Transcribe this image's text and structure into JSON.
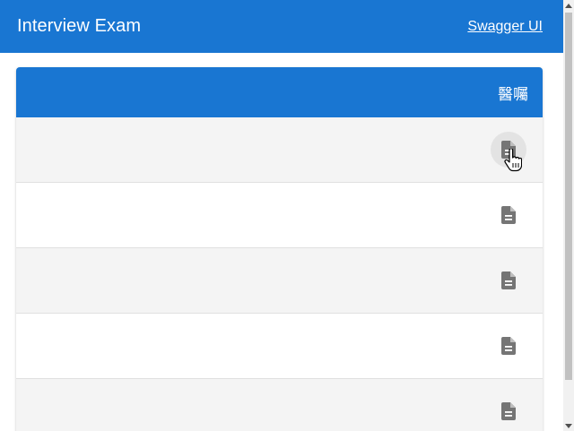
{
  "header": {
    "title": "Interview Exam",
    "swagger_link": "Swagger UI"
  },
  "table": {
    "column_header": "醫囑",
    "rows": [
      {
        "action_icon": "description-icon",
        "hovered": true
      },
      {
        "action_icon": "description-icon",
        "hovered": false
      },
      {
        "action_icon": "description-icon",
        "hovered": false
      },
      {
        "action_icon": "description-icon",
        "hovered": false
      },
      {
        "action_icon": "description-icon",
        "hovered": false
      }
    ]
  },
  "colors": {
    "primary": "#1976d2",
    "row_alt": "#f4f4f4",
    "icon": "#757575"
  }
}
